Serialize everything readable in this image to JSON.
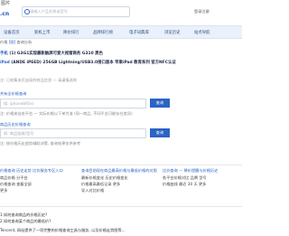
{
  "header": {
    "logo_top": "图芹",
    "logo_brand": ".cn",
    "search_placeholder": "请输入产品名称或型号",
    "top_right": "登录注册"
  },
  "nav": {
    "items": [
      "设备首页",
      "新机上市",
      "降价排行",
      "品牌排行榜",
      "电子词典库",
      "浏览历史",
      "站点导航"
    ]
  },
  "breadcrumb": {
    "prefix": "价格",
    "pic": "[图]",
    "text": "查询分析"
  },
  "rows": [
    {
      "pre": "手机",
      "text": "(1) G3G1实现最新触屏可爱大视窗商务 G310 黑色"
    },
    {
      "pre": "iPad",
      "text": "(ANDE iPEED) 256GB Lightning/USB3.0接口版本 苹果iPad 教育系列 官方NFC认证"
    }
  ],
  "notice": "注: 已收集本页出现的商品信息 — 请谨慎选购",
  "fold": {
    "label1": "共有全价格查询",
    "placeholder1": "如: iphone8/6/xr",
    "btn1": "查询",
    "hint1": "注: 价格来自各平台 — 实际价格以下单为准 (同一商品, 不同平台可能存在差异)",
    "label2": "商品历史价格查询",
    "placeholder2": "如: 商品链接/型号",
    "btn2": "查询",
    "hint2": "注: 按价格历史趋势辅助决策, 查询结果仅供参考"
  },
  "columns": [
    {
      "title": "价格查询 历史走势 比价服务专区入口",
      "lines": [
        "商品价格 分平台",
        "价格查询 查看全部",
        "更多"
      ]
    },
    {
      "title": "查询目前现在商品最高价格与最低价格的对照",
      "lines": [
        "最新价格变化 历史价格变化",
        "价格最高最低记录 更多",
        "导入对比价格"
      ]
    },
    {
      "title": "比价查询 — 降价提醒与价格历史",
      "lines": [
        "各平台价格对比 品牌 型号",
        "价格曲线 最近 30 天 更多"
      ]
    }
  ],
  "faq": {
    "q1": "1.如何查询商品的价格历史?",
    "q2": "2.如何查询某个商品的最低价?",
    "answer": "Tencent, 网站提供了一项完整的价格查询工具与服务, 以及价格走势图等..."
  }
}
